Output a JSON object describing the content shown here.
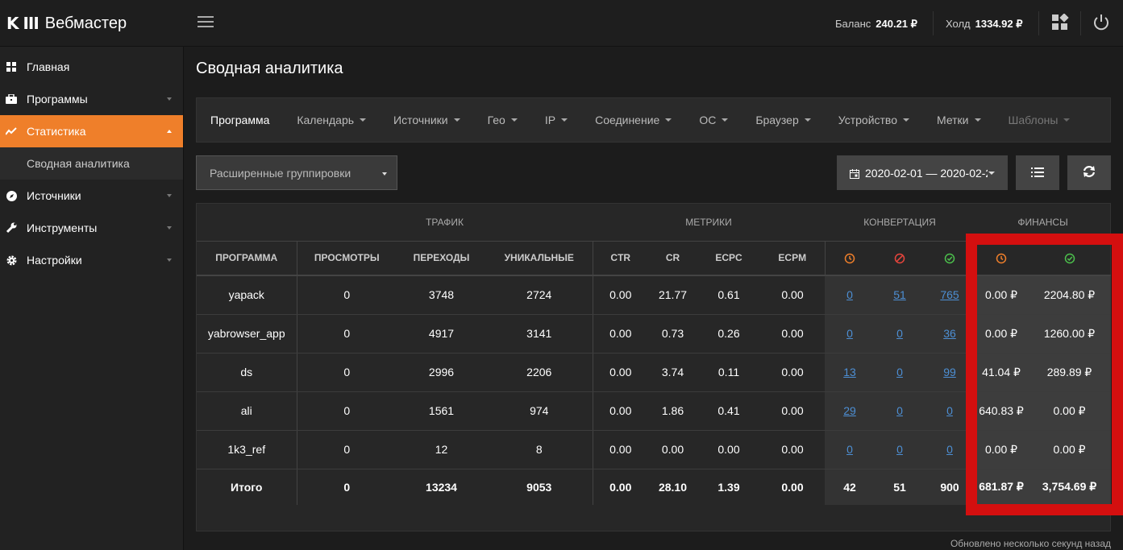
{
  "app": {
    "logo_mark": "K",
    "logo_bars": "III",
    "title": "Вебмастер"
  },
  "topbar": {
    "balance_label": "Баланс",
    "balance_value": "240.21 ₽",
    "hold_label": "Холд",
    "hold_value": "1334.92 ₽"
  },
  "sidebar": {
    "items": [
      {
        "label": "Главная",
        "icon": "dashboard-icon"
      },
      {
        "label": "Программы",
        "icon": "briefcase-icon"
      },
      {
        "label": "Статистика",
        "icon": "chart-line-icon"
      },
      {
        "label": "Источники",
        "icon": "compass-icon"
      },
      {
        "label": "Инструменты",
        "icon": "wrench-icon"
      },
      {
        "label": "Настройки",
        "icon": "gear-icon"
      }
    ],
    "sub_item": "Сводная аналитика"
  },
  "page": {
    "title": "Сводная аналитика"
  },
  "filters": [
    "Программа",
    "Календарь",
    "Источники",
    "Гео",
    "IP",
    "Соединение",
    "ОС",
    "Браузер",
    "Устройство",
    "Метки",
    "Шаблоны"
  ],
  "grouping": {
    "label": "Расширенные группировки"
  },
  "date_range": {
    "value": "2020-02-01 — 2020-02-2"
  },
  "table": {
    "groups": {
      "traffic": "ТРАФИК",
      "metrics": "МЕТРИКИ",
      "conversion": "КОНВЕРТАЦИЯ",
      "finance": "ФИНАНСЫ"
    },
    "headers": {
      "program": "ПРОГРАММА",
      "views": "ПРОСМОТРЫ",
      "clicks": "ПЕРЕХОДЫ",
      "unique": "УНИКАЛЬНЫЕ",
      "ctr": "CTR",
      "cr": "CR",
      "ecpc": "ECPC",
      "ecpm": "ECPM"
    },
    "rows": [
      {
        "program": "yapack",
        "views": "0",
        "clicks": "3748",
        "unique": "2724",
        "ctr": "0.00",
        "cr": "21.77",
        "ecpc": "0.61",
        "ecpm": "0.00",
        "conv_pending": "0",
        "conv_rejected": "51",
        "conv_approved": "765",
        "fin_pending": "0.00 ₽",
        "fin_approved": "2204.80 ₽"
      },
      {
        "program": "yabrowser_app",
        "views": "0",
        "clicks": "4917",
        "unique": "3141",
        "ctr": "0.00",
        "cr": "0.73",
        "ecpc": "0.26",
        "ecpm": "0.00",
        "conv_pending": "0",
        "conv_rejected": "0",
        "conv_approved": "36",
        "fin_pending": "0.00 ₽",
        "fin_approved": "1260.00 ₽"
      },
      {
        "program": "ds",
        "views": "0",
        "clicks": "2996",
        "unique": "2206",
        "ctr": "0.00",
        "cr": "3.74",
        "ecpc": "0.11",
        "ecpm": "0.00",
        "conv_pending": "13",
        "conv_rejected": "0",
        "conv_approved": "99",
        "fin_pending": "41.04 ₽",
        "fin_approved": "289.89 ₽"
      },
      {
        "program": "ali",
        "views": "0",
        "clicks": "1561",
        "unique": "974",
        "ctr": "0.00",
        "cr": "1.86",
        "ecpc": "0.41",
        "ecpm": "0.00",
        "conv_pending": "29",
        "conv_rejected": "0",
        "conv_approved": "0",
        "fin_pending": "640.83 ₽",
        "fin_approved": "0.00 ₽"
      },
      {
        "program": "1k3_ref",
        "views": "0",
        "clicks": "12",
        "unique": "8",
        "ctr": "0.00",
        "cr": "0.00",
        "ecpc": "0.00",
        "ecpm": "0.00",
        "conv_pending": "0",
        "conv_rejected": "0",
        "conv_approved": "0",
        "fin_pending": "0.00 ₽",
        "fin_approved": "0.00 ₽"
      }
    ],
    "total": {
      "program": "Итого",
      "views": "0",
      "clicks": "13234",
      "unique": "9053",
      "ctr": "0.00",
      "cr": "28.10",
      "ecpc": "1.39",
      "ecpm": "0.00",
      "conv_pending": "42",
      "conv_rejected": "51",
      "conv_approved": "900",
      "fin_pending": "681.87 ₽",
      "fin_approved": "3,754.69 ₽"
    }
  },
  "status": {
    "updated": "Обновлено несколько секунд назад"
  },
  "colors": {
    "accent": "#ef7f2a",
    "pending": "#ef7f2a",
    "rejected": "#e8453c",
    "approved": "#4cc04c",
    "link": "#4d8fd4",
    "highlight": "#d40f0f"
  }
}
